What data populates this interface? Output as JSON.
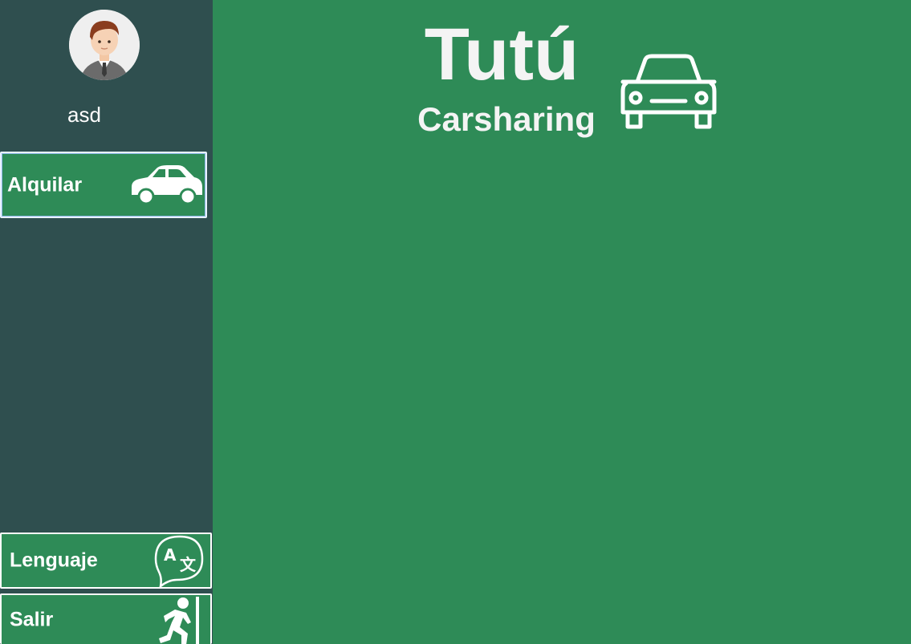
{
  "user": {
    "name": "asd"
  },
  "sidebar": {
    "items": [
      {
        "label": "Alquilar",
        "icon": "car-icon"
      },
      {
        "label": "Lenguaje",
        "icon": "translate-icon"
      },
      {
        "label": "Salir",
        "icon": "exit-icon"
      }
    ]
  },
  "header": {
    "title": "Tutú",
    "subtitle": "Carsharing",
    "icon": "car-outline-icon"
  },
  "colors": {
    "sidebar_bg": "#2f4f4f",
    "main_bg": "#2e8b57",
    "text": "#ffffff"
  }
}
